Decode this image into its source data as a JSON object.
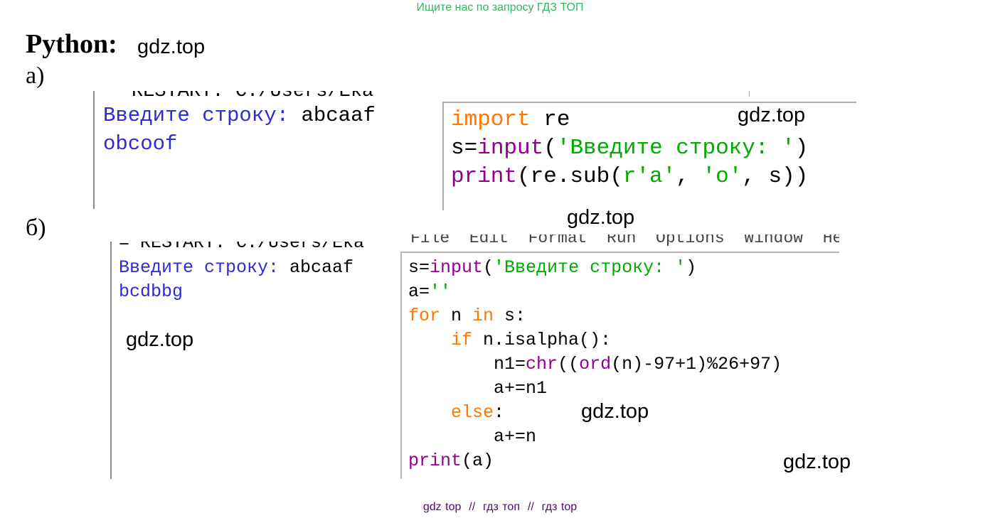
{
  "banner": "Ищите нас по запросу ГДЗ ТОП",
  "heading": "Python:",
  "watermark": "gdz.top",
  "part_a": {
    "label": "а)",
    "shell_cut": "RESTART: C:/Users/Eka",
    "shell_prompt": "Введите строку: ",
    "shell_input": "abcaaf",
    "shell_output": "obcoof",
    "code": {
      "line1": {
        "kw": "import",
        "rest": " re"
      },
      "line2": {
        "a": "s=",
        "fn": "input",
        "b": "(",
        "str": "'Введите строку: '",
        "c": ")"
      },
      "line3": {
        "fn": "print",
        "a": "(re.sub(",
        "s1": "r'a'",
        "b": ", ",
        "s2": "'o'",
        "c": ", s))"
      }
    }
  },
  "part_b": {
    "label": "б)",
    "shell_cut": "= RESTART: C:/Users/Eka",
    "menu_cut": "File  Edit  Format  Run  Options  Window  He",
    "shell_prompt": "Введите строку: ",
    "shell_input": "abcaaf",
    "shell_output": "bcdbbg",
    "code": {
      "l1": {
        "a": "s=",
        "fn": "input",
        "b": "(",
        "str": "'Введите строку: '",
        "c": ")"
      },
      "l2": {
        "a": "a=",
        "str": "''"
      },
      "l3": {
        "kw1": "for",
        "a": " n ",
        "kw2": "in",
        "b": " s:"
      },
      "l4": {
        "ind": "    ",
        "kw": "if",
        "a": " n.isalpha():"
      },
      "l5": {
        "ind": "        ",
        "a": "n1=",
        "fn1": "chr",
        "b": "((",
        "fn2": "ord",
        "c": "(n)-97+1)%26+97)"
      },
      "l6": {
        "ind": "        ",
        "a": "a+=n1"
      },
      "l7": {
        "ind": "    ",
        "kw": "else",
        "a": ":"
      },
      "l8": {
        "ind": "        ",
        "a": "a+=n"
      },
      "l9": {
        "fn": "print",
        "a": "(a)"
      }
    }
  },
  "footer": "gdz top  //  гдз топ  //  гдз top"
}
